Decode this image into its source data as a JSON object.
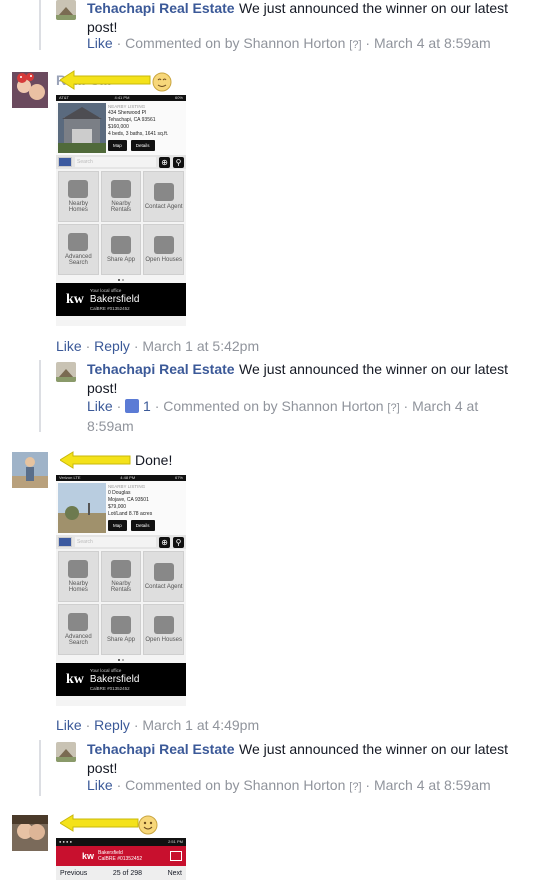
{
  "comments": [
    {
      "id": "reply-top",
      "page_name": "Tehachapi Real Estate",
      "text_line1": "We just announced the winner on our latest",
      "text_line2": "post!",
      "like": "Like",
      "meta": " · Commented on by Shannon Horton ",
      "help": "[?]",
      "time": " · March 4 at 8:59am"
    },
    {
      "id": "c1",
      "author_hidden": "Re... C...",
      "listing": {
        "status_left": "AT&T",
        "status_mid": "4:41 PM",
        "status_right": "60%",
        "header": "NEARBY LISTING",
        "address1": "434 Sherwood Pl",
        "address2": "Tehachapi, CA 93561",
        "price": "$160,000",
        "specs": "4 beds, 3 baths, 1641 sq.ft."
      },
      "like": "Like",
      "reply": "Reply",
      "time": "March 1 at 5:42pm",
      "reply_page": "Tehachapi Real Estate",
      "reply_text1": "We just announced the winner on our latest",
      "reply_text2": "post!",
      "reply_like": "Like",
      "reply_like_count": "1",
      "reply_meta": " · Commented on by Shannon Horton ",
      "reply_help": "[?]",
      "reply_time1": " · March 4 at",
      "reply_time2": "8:59am"
    },
    {
      "id": "c2",
      "text": "Done!",
      "listing": {
        "status_left": "Verizon LTE",
        "status_mid": "4:48 PM",
        "status_right": "67%",
        "header": "NEARBY LISTING",
        "address1": "0 Douglas",
        "address2": "Mojave, CA 93501",
        "price": "$79,000",
        "specs": "Lot/Land 8.78 acres"
      },
      "like": "Like",
      "reply": "Reply",
      "time": "March 1 at 4:49pm",
      "reply_page": "Tehachapi Real Estate",
      "reply_text1": "We just announced the winner on our latest",
      "reply_text2": "post!",
      "reply_like": "Like",
      "reply_meta": " · Commented on by Shannon Horton ",
      "reply_help": "[?]",
      "reply_time": " · March 4 at 8:59am"
    }
  ],
  "app": {
    "map_btn": "Map",
    "details_btn": "Details",
    "search_placeholder": "Search",
    "tiles": [
      "Nearby Homes",
      "Nearby Rentals",
      "Contact Agent",
      "Advanced Search",
      "Share App",
      "Open Houses"
    ],
    "kw_logo": "kw",
    "office_small": "Your local office",
    "office": "Bakersfield",
    "calbre": "CalBRE #01352452"
  },
  "bottom_phone": {
    "status_time": "2:51 PM",
    "office": "Bakersfield",
    "calbre": "CalBRE #01352452",
    "prev": "Previous",
    "count": "25 of 298",
    "next": "Next"
  },
  "colors": {
    "link": "#3b5998",
    "meta": "#90949c",
    "arrow": "#f4e21a"
  }
}
